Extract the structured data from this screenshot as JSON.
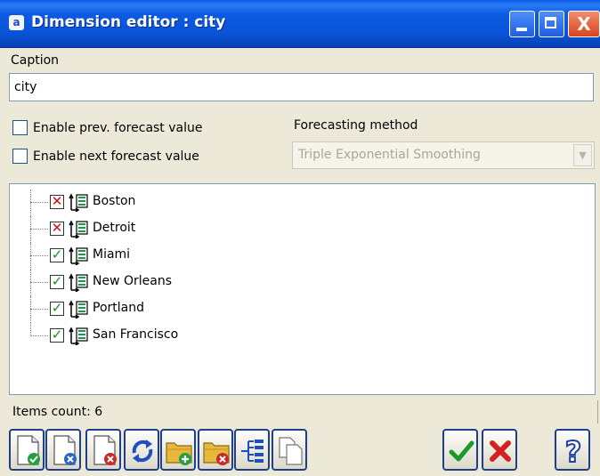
{
  "window": {
    "icon_letter": "a",
    "title": "Dimension editor :  city",
    "controls": {
      "minimize": "minimize",
      "maximize": "maximize",
      "close": "X"
    }
  },
  "caption": {
    "label": "Caption",
    "value": "city"
  },
  "options": {
    "prev_forecast_label": "Enable prev. forecast value",
    "prev_forecast_checked": false,
    "next_forecast_label": "Enable next forecast value",
    "next_forecast_checked": false
  },
  "forecasting": {
    "label": "Forecasting method",
    "selected": "Triple Exponential Smoothing",
    "enabled": false
  },
  "items": [
    {
      "label": "Boston",
      "state": "excluded",
      "mark": "✕"
    },
    {
      "label": "Detroit",
      "state": "excluded",
      "mark": "✕"
    },
    {
      "label": "Miami",
      "state": "included",
      "mark": "✓"
    },
    {
      "label": "New Orleans",
      "state": "included",
      "mark": "✓"
    },
    {
      "label": "Portland",
      "state": "included",
      "mark": "✓"
    },
    {
      "label": "San Francisco",
      "state": "included",
      "mark": "✓"
    }
  ],
  "status": {
    "items_count": "Items count: 6"
  },
  "toolbar": [
    {
      "name": "select-all-button",
      "icon": "document-check-icon"
    },
    {
      "name": "deselect-button",
      "icon": "document-blue-x-icon"
    },
    {
      "name": "remove-item-button",
      "icon": "document-red-x-icon"
    },
    {
      "name": "refresh-button",
      "icon": "refresh-arrows-icon"
    },
    {
      "name": "add-folder-button",
      "icon": "folder-add-icon"
    },
    {
      "name": "remove-folder-button",
      "icon": "folder-remove-icon"
    },
    {
      "name": "hierarchy-button",
      "icon": "hierarchy-icon"
    },
    {
      "name": "copy-button",
      "icon": "copy-pages-icon"
    },
    {
      "name": "ok-button",
      "icon": "green-check-icon"
    },
    {
      "name": "cancel-button",
      "icon": "red-x-icon"
    },
    {
      "name": "help-button",
      "icon": "question-mark-icon"
    }
  ],
  "colors": {
    "title_bar": "#0a54d8",
    "dialog_bg": "#ece9d8",
    "included": "#189018",
    "excluded": "#d01010"
  }
}
